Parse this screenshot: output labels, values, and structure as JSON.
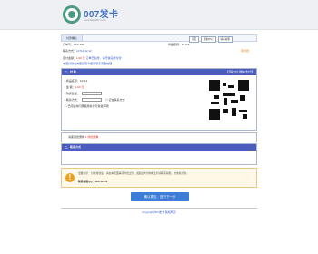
{
  "header": {
    "brand": "007发卡",
    "subtitle": "www.faka007.com"
  },
  "breadcrumb": {
    "items": [
      "付款确认",
      "填写联系方式",
      "选择支付方式并付款",
      "确认订单"
    ],
    "right_links": [
      "首页",
      "帮助中心",
      "联系客服"
    ]
  },
  "order": {
    "order_no_label": "订单号：",
    "order_no": "1217122",
    "goods_label": "商品名称：",
    "goods_value": "12712",
    "phone_label": "联系方式：",
    "phone_value": "12712 12 12",
    "amount_label": "应付金额：",
    "amount_value": "1.00 元",
    "hint": "订单已生成，请尽快完成付款",
    "tip_text": "◆ 若付款后未能提取卡密请联系客服处理"
  },
  "pay_panel": {
    "title": "一、付  款",
    "right": "扫码支付·微信/支付宝",
    "rows": [
      {
        "label": "• 商品名称：",
        "value": "12712"
      },
      {
        "label": "• 金    额：",
        "value": "1.00 元"
      },
      {
        "label": "• 购买数量：",
        "value": "1"
      },
      {
        "label": "• 联系方式：",
        "value": ""
      }
    ],
    "checkbox1": "记住联系方式",
    "checkbox2": "已阅读并同意使用条款与免责声明"
  },
  "coupon": {
    "label": "请使用优惠券",
    "value": "1 件优惠券"
  },
  "contact_panel": {
    "title": "二、联系方式",
    "right": ""
  },
  "note": {
    "line1": "温馨提示：付款成功后，请在本页面等待卡密显示，如超过5分钟未显示请联系客服，勿重复付款。",
    "line2": "联系客服QQ：123712211"
  },
  "submit_label": "确认提交，进行下一步",
  "footer": "Copyright 007发卡 版权所有"
}
